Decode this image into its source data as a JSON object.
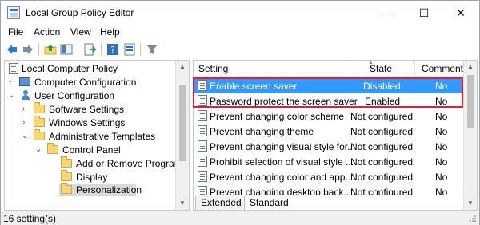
{
  "window": {
    "title": "Local Group Policy Editor"
  },
  "window_controls": {
    "minimize": "—",
    "maximize": "☐",
    "close": "✕"
  },
  "menu": [
    "File",
    "Action",
    "View",
    "Help"
  ],
  "tree": {
    "root": "Local Computer Policy",
    "computer_config": "Computer Configuration",
    "user_config": "User Configuration",
    "software_settings": "Software Settings",
    "windows_settings": "Windows Settings",
    "admin_templates": "Administrative Templates",
    "control_panel": "Control Panel",
    "add_remove": "Add or Remove Programs",
    "display": "Display",
    "personalization": "Personalization"
  },
  "columns": {
    "setting": "Setting",
    "state": "State",
    "comment": "Comment"
  },
  "rows": [
    {
      "setting": "Enable screen saver",
      "state": "Disabled",
      "comment": "No"
    },
    {
      "setting": "Password protect the screen saver",
      "state": "Enabled",
      "comment": "No"
    },
    {
      "setting": "Prevent changing color scheme",
      "state": "Not configured",
      "comment": "No"
    },
    {
      "setting": "Prevent changing theme",
      "state": "Not configured",
      "comment": "No"
    },
    {
      "setting": "Prevent changing visual style for...",
      "state": "Not configured",
      "comment": "No"
    },
    {
      "setting": "Prohibit selection of visual style ...",
      "state": "Not configured",
      "comment": "No"
    },
    {
      "setting": "Prevent changing color and app...",
      "state": "Not configured",
      "comment": "No"
    },
    {
      "setting": "Prevent changing desktop back...",
      "state": "Not configured",
      "comment": "No"
    }
  ],
  "tabs": [
    "Extended",
    "Standard"
  ],
  "status": {
    "text": "16 setting(s)"
  },
  "colors": {
    "selection": "#3399ff",
    "highlight_box": "#e0202a"
  }
}
